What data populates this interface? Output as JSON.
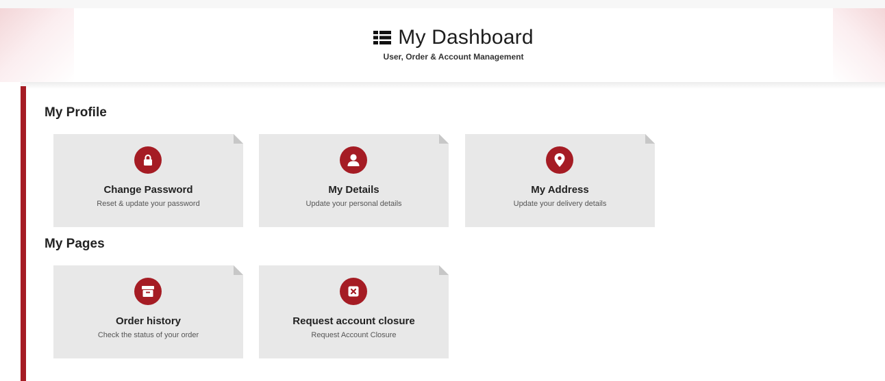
{
  "header": {
    "title": "My Dashboard",
    "subtitle": "User, Order & Account Management",
    "title_icon": "dashboard-grid-icon"
  },
  "sections": [
    {
      "heading": "My Profile",
      "cards": [
        {
          "title": "Change Password",
          "description": "Reset & update your password",
          "icon": "lock-icon"
        },
        {
          "title": "My Details",
          "description": "Update your personal details",
          "icon": "user-icon"
        },
        {
          "title": "My Address",
          "description": "Update your delivery details",
          "icon": "map-pin-icon"
        }
      ]
    },
    {
      "heading": "My Pages",
      "cards": [
        {
          "title": "Order history",
          "description": "Check the status of your order",
          "icon": "archive-box-icon"
        },
        {
          "title": "Request account closure",
          "description": "Request Account Closure",
          "icon": "close-box-icon"
        }
      ]
    }
  ],
  "colors": {
    "accent": "#a51c24",
    "card_background": "#e8e8e8",
    "card_fold": "#c7c7c7"
  }
}
